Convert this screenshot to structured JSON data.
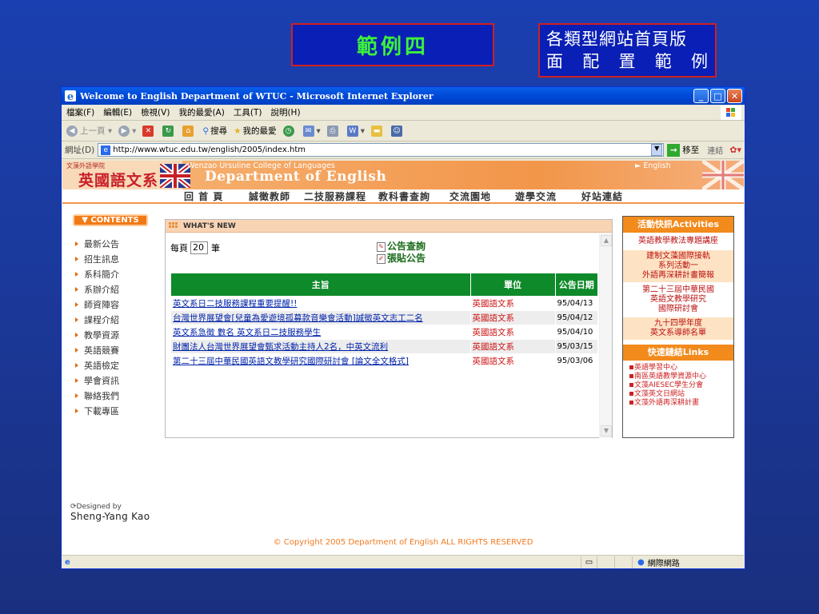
{
  "slide": {
    "title": "範例四",
    "note_line1": "各類型網站首頁版",
    "note_line2_chars": [
      "面",
      "配",
      "置",
      "範",
      "例"
    ]
  },
  "window": {
    "title": "Welcome to English Department of WTUC - Microsoft Internet Explorer",
    "controls": [
      "minimize",
      "maximize",
      "close"
    ]
  },
  "menu": [
    "檔案(F)",
    "編輯(E)",
    "檢視(V)",
    "我的最愛(A)",
    "工具(T)",
    "說明(H)"
  ],
  "toolbar": {
    "back": "上一頁",
    "search": "搜尋",
    "favorites": "我的最愛"
  },
  "address": {
    "label": "網址(D)",
    "url": "http://www.wtuc.edu.tw/english/2005/index.htm",
    "go": "移至",
    "links": "連結"
  },
  "site": {
    "logo_small": "文藻外語學院",
    "logo_big": "英國語文系",
    "college": "Wenzao Ursuline College of Languages",
    "dept": "Department of English",
    "english_link": "► English",
    "nav": [
      "回 首 頁",
      "誠徵教師",
      "二技服務課程",
      "教科書查詢",
      "交流園地",
      "遊學交流",
      "好站連結"
    ]
  },
  "contents": {
    "header": "▼ CONTENTS",
    "items": [
      "最新公告",
      "招生訊息",
      "系科簡介",
      "系辦介紹",
      "師資陣容",
      "課程介紹",
      "教學資源",
      "英語競賽",
      "英語檢定",
      "學會資訊",
      "聯絡我們",
      "下載專區"
    ],
    "designed_by": "Designed by",
    "designer": "Sheng-Yang Kao"
  },
  "news": {
    "header": "WHAT'S NEW",
    "per_page_label": "每頁",
    "per_page_value": "20",
    "per_page_unit": "筆",
    "action_query": "公告查詢",
    "action_post": "張貼公告",
    "columns": [
      "主旨",
      "單位",
      "公告日期"
    ],
    "rows": [
      {
        "subject": "英文系日二技服務課程重要提醒!!",
        "unit": "英國語文系",
        "date": "95/04/13"
      },
      {
        "subject": "台灣世界展望會[兒童為愛遊境孤募款音樂會活動]誠徵英文志工二名",
        "unit": "英國語文系",
        "date": "95/04/12"
      },
      {
        "subject": "英文系急徵 數名 英文系日二技服務學生",
        "unit": "英國語文系",
        "date": "95/04/10"
      },
      {
        "subject": "財團法人台灣世界展望會甄求活動主持人2名，中英文流利",
        "unit": "英國語文系",
        "date": "95/03/15"
      },
      {
        "subject": "第二十三屆中華民國英語文教學研究國際研討會 [論文全文格式]",
        "unit": "英國語文系",
        "date": "95/03/06"
      }
    ]
  },
  "activities": {
    "header": "活動快訊Activities",
    "items": [
      {
        "text": "英語教學教法專題講座",
        "shaded": false
      },
      {
        "text": "建制文藻國際接軌\n系列活動一\n外語再深耕計畫簡報",
        "shaded": true
      },
      {
        "text": "第二十三屆中華民國\n英語文教學研究\n國際研討會",
        "shaded": false
      },
      {
        "text": "九十四學年度\n英文系導師名單",
        "shaded": true
      }
    ]
  },
  "links": {
    "header": "快速鏈結Links",
    "items": [
      "英語學習中心",
      "南區英語教學資源中心",
      "文藻AIESEC學生分會",
      "文藻英文日網站",
      "文藻外語再深耕計畫"
    ]
  },
  "footer": {
    "copyright": "© Copyright 2005 Department of English ALL RIGHTS RESERVED"
  },
  "status": {
    "zone": "網際網路"
  }
}
